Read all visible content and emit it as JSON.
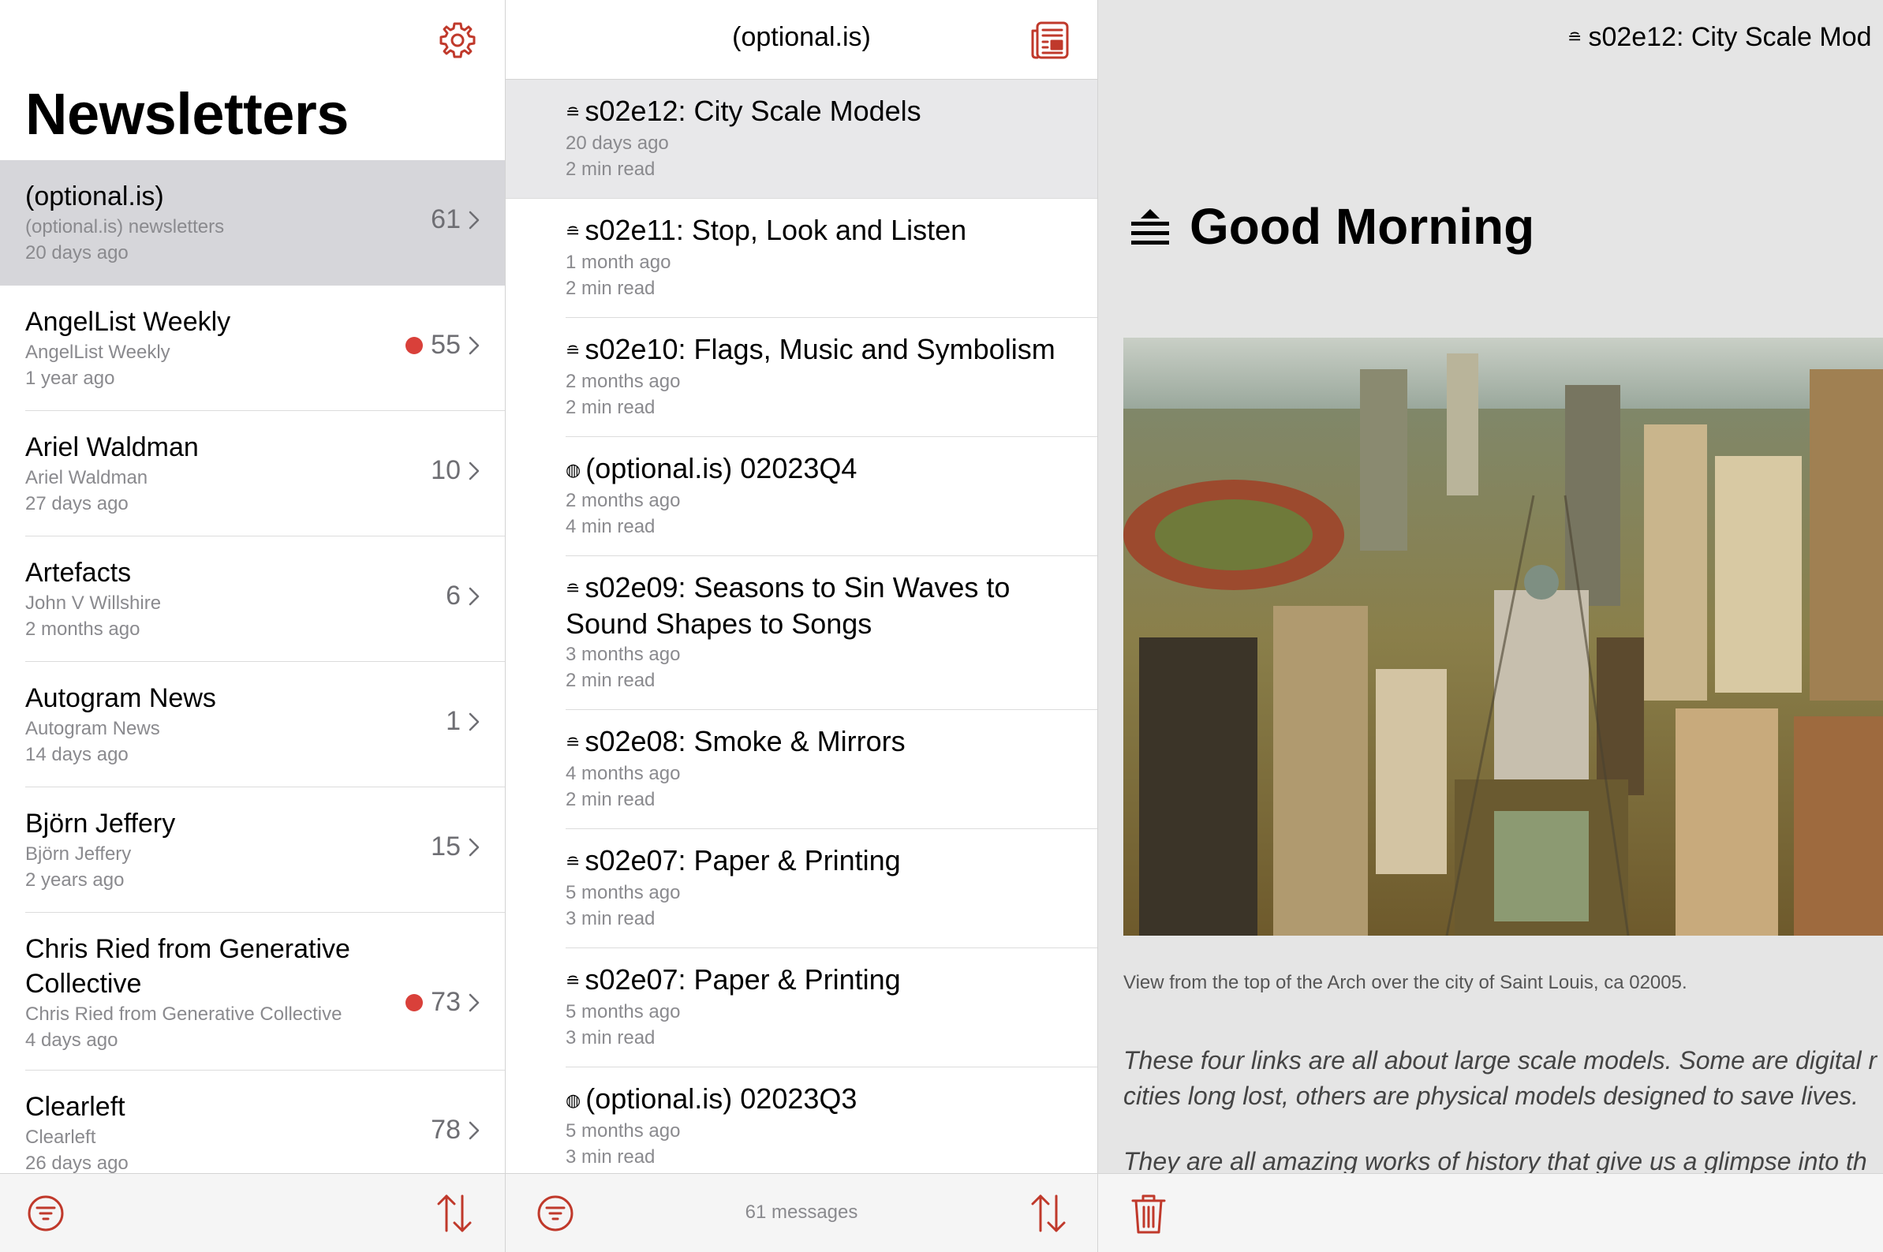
{
  "left": {
    "title": "Newsletters",
    "items": [
      {
        "name": "(optional.is)",
        "author": "(optional.is) newsletters",
        "time": "20 days ago",
        "count": "61",
        "unread": false,
        "selected": true
      },
      {
        "name": "AngelList Weekly",
        "author": "AngelList Weekly",
        "time": "1 year ago",
        "count": "55",
        "unread": true
      },
      {
        "name": "Ariel Waldman",
        "author": "Ariel Waldman",
        "time": "27 days ago",
        "count": "10",
        "unread": false
      },
      {
        "name": "Artefacts",
        "author": "John V Willshire",
        "time": "2 months ago",
        "count": "6",
        "unread": false
      },
      {
        "name": "Autogram News",
        "author": "Autogram News",
        "time": "14 days ago",
        "count": "1",
        "unread": false
      },
      {
        "name": "Björn Jeffery",
        "author": "Björn Jeffery",
        "time": "2 years ago",
        "count": "15",
        "unread": false
      },
      {
        "name": "Chris Ried from Generative Collective",
        "author": "Chris Ried from Generative Collective",
        "time": "4 days ago",
        "count": "73",
        "unread": true
      },
      {
        "name": "Clearleft",
        "author": "Clearleft",
        "time": "26 days ago",
        "count": "78",
        "unread": false
      }
    ]
  },
  "middle": {
    "title": "(optional.is)",
    "footer": "61 messages",
    "messages": [
      {
        "glyph": "≘",
        "title": "s02e12: City Scale Models",
        "date": "20 days ago",
        "read": "2 min read",
        "selected": true
      },
      {
        "glyph": "≘",
        "title": "s02e11: Stop, Look and Listen",
        "date": "1 month ago",
        "read": "2 min read"
      },
      {
        "glyph": "≘",
        "title": "s02e10: Flags, Music and Symbolism",
        "date": "2 months ago",
        "read": "2 min read"
      },
      {
        "glyph": "◍",
        "title": "(optional.is) 02023Q4",
        "date": "2 months ago",
        "read": "4 min read"
      },
      {
        "glyph": "≘",
        "title": "s02e09: Seasons to Sin Waves to Sound Shapes to Songs",
        "date": "3 months ago",
        "read": "2 min read"
      },
      {
        "glyph": "≘",
        "title": "s02e08: Smoke & Mirrors",
        "date": "4 months ago",
        "read": "2 min read"
      },
      {
        "glyph": "≘",
        "title": "s02e07: Paper & Printing",
        "date": "5 months ago",
        "read": "3 min read"
      },
      {
        "glyph": "≘",
        "title": "s02e07: Paper & Printing",
        "date": "5 months ago",
        "read": "3 min read"
      },
      {
        "glyph": "◍",
        "title": "(optional.is) 02023Q3",
        "date": "5 months ago",
        "read": "3 min read"
      }
    ]
  },
  "right": {
    "top_glyph": "≘",
    "top_title": "s02e12: City Scale Mod",
    "heading": "Good Morning",
    "caption": "View from the top of the Arch over the city of Saint Louis, ca 02005.",
    "para1_line1": "These four links are all about large scale models. Some are digital r",
    "para1_line2": "cities long lost, others are physical models designed to save lives.",
    "para2_line1": "They are all amazing works of history that give us a glimpse into th"
  },
  "icons": {
    "settings": "gear-icon",
    "filter": "filter-icon",
    "sort": "sort-icon",
    "reader": "reader-icon",
    "trash": "trash-icon",
    "chevron": "chevron-right-icon"
  },
  "colors": {
    "accent": "#c0392b",
    "unread_dot": "#d9403a"
  }
}
